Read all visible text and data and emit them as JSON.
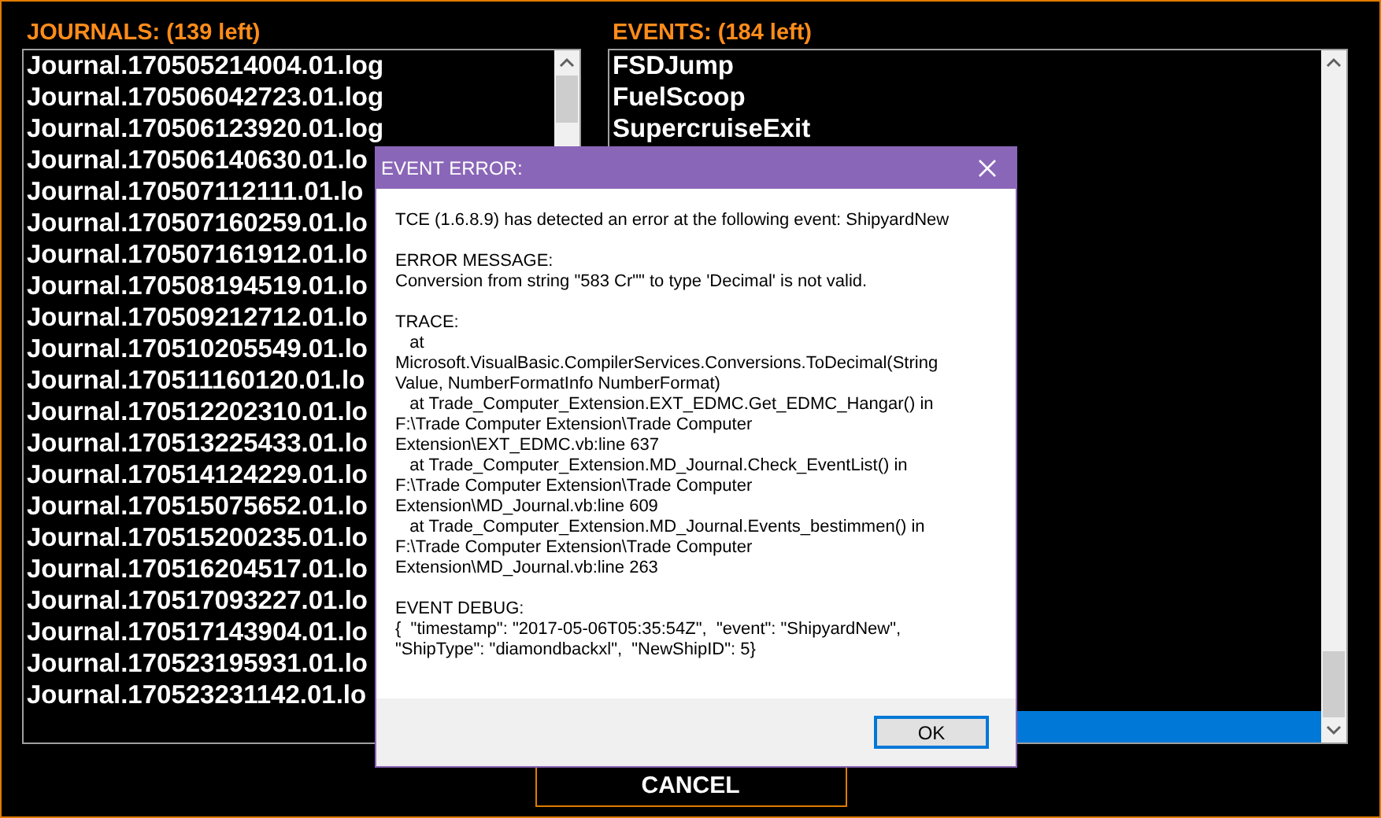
{
  "journals": {
    "title": "JOURNALS: (139 left)",
    "items": [
      {
        "label": "Journal.170505214004.01.log"
      },
      {
        "label": "Journal.170506042723.01.log"
      },
      {
        "label": "Journal.170506123920.01.log"
      },
      {
        "label": "Journal.170506140630.01.lo"
      },
      {
        "label": "Journal.170507112111.01.lo"
      },
      {
        "label": "Journal.170507160259.01.lo"
      },
      {
        "label": "Journal.170507161912.01.lo"
      },
      {
        "label": "Journal.170508194519.01.lo"
      },
      {
        "label": "Journal.170509212712.01.lo"
      },
      {
        "label": "Journal.170510205549.01.lo"
      },
      {
        "label": "Journal.170511160120.01.lo"
      },
      {
        "label": "Journal.170512202310.01.lo"
      },
      {
        "label": "Journal.170513225433.01.lo"
      },
      {
        "label": "Journal.170514124229.01.lo"
      },
      {
        "label": "Journal.170515075652.01.lo"
      },
      {
        "label": "Journal.170515200235.01.lo"
      },
      {
        "label": "Journal.170516204517.01.lo"
      },
      {
        "label": "Journal.170517093227.01.lo"
      },
      {
        "label": "Journal.170517143904.01.lo"
      },
      {
        "label": "Journal.170523195931.01.lo"
      },
      {
        "label": "Journal.170523231142.01.lo"
      }
    ]
  },
  "events": {
    "title": "EVENTS: (184 left)",
    "items": [
      {
        "label": "FSDJump",
        "selected": false
      },
      {
        "label": "FuelScoop",
        "selected": false
      },
      {
        "label": "SupercruiseExit",
        "selected": false
      },
      {
        "selected": true
      }
    ]
  },
  "cancel_button": "CANCEL",
  "dialog": {
    "title": "EVENT ERROR:",
    "sections": [
      {
        "lines": [
          "TCE (1.6.8.9) has detected an error at the following event: ShipyardNew"
        ]
      },
      {
        "lines": [
          "ERROR MESSAGE:",
          "Conversion from string \"583 Cr\"\" to type 'Decimal' is not valid."
        ]
      },
      {
        "lines": [
          "TRACE:",
          "   at",
          "Microsoft.VisualBasic.CompilerServices.Conversions.ToDecimal(String",
          "Value, NumberFormatInfo NumberFormat)",
          "   at Trade_Computer_Extension.EXT_EDMC.Get_EDMC_Hangar() in",
          "F:\\Trade Computer Extension\\Trade Computer",
          "Extension\\EXT_EDMC.vb:line 637",
          "   at Trade_Computer_Extension.MD_Journal.Check_EventList() in",
          "F:\\Trade Computer Extension\\Trade Computer",
          "Extension\\MD_Journal.vb:line 609",
          "   at Trade_Computer_Extension.MD_Journal.Events_bestimmen() in",
          "F:\\Trade Computer Extension\\Trade Computer",
          "Extension\\MD_Journal.vb:line 263"
        ]
      },
      {
        "lines": [
          "EVENT DEBUG:",
          "{  \"timestamp\": \"2017-05-06T05:35:54Z\",  \"event\": \"ShipyardNew\",",
          "\"ShipType\": \"diamondbackxl\",  \"NewShipID\": 5}"
        ]
      }
    ],
    "ok_button": "OK"
  }
}
